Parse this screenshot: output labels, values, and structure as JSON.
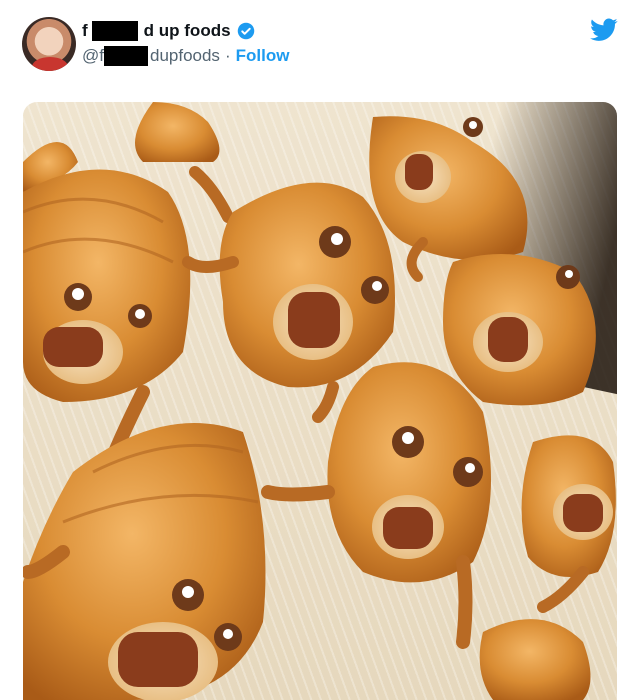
{
  "tweet": {
    "display_name_prefix": "f",
    "display_name_suffix": "d up foods",
    "handle_prefix": "@f",
    "handle_suffix": "dupfoods",
    "separator": "·",
    "follow_label": "Follow",
    "verified": true
  },
  "media": {
    "alt_description": "photo"
  },
  "colors": {
    "link": "#1d9bf0",
    "text_primary": "#0f1419",
    "text_secondary": "#536471",
    "bread": "#d58a2f"
  },
  "icons": {
    "verified": "verified-badge-icon",
    "twitter": "twitter-bird-icon"
  }
}
